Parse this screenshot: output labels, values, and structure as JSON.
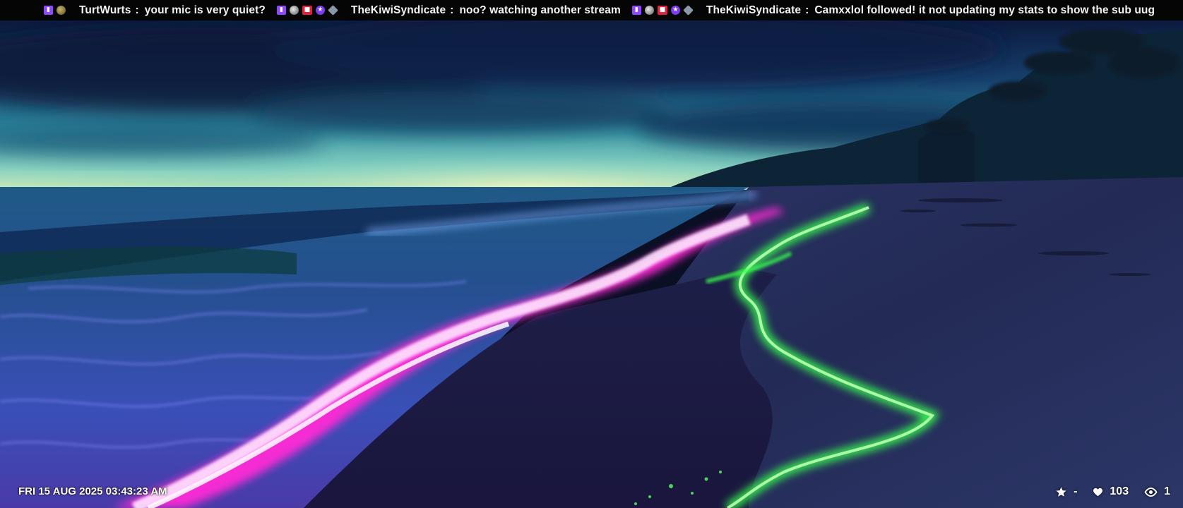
{
  "ticker": {
    "messages": [
      {
        "badges": [
          "twitch-icon",
          "avatar-icon"
        ],
        "user": "TurtWurts",
        "separator": ":",
        "text": "your mic is very quiet?"
      },
      {
        "badges": [
          "twitch-icon",
          "avatar-icon",
          "camera-icon",
          "star-icon",
          "gem-icon"
        ],
        "user": "TheKiwiSyndicate",
        "separator": ":",
        "text": "noo?  watching another stream"
      },
      {
        "badges": [
          "twitch-icon",
          "avatar-icon",
          "camera-icon",
          "star-icon",
          "gem-icon"
        ],
        "user": "TheKiwiSyndicate",
        "separator": ":",
        "text": "Camxxlol followed!  it not updating my stats to show the sub uug"
      }
    ]
  },
  "overlay": {
    "datetime": "FRI 15 AUG 2025 03:43:23 AM",
    "stats": {
      "favorites": "-",
      "likes": "103",
      "viewers": "1"
    }
  },
  "colors": {
    "ticker_bg": "#050505",
    "twitch_purple": "#9146ff",
    "glow_pink": "#ff2bd6",
    "glow_green": "#39ff4f"
  }
}
